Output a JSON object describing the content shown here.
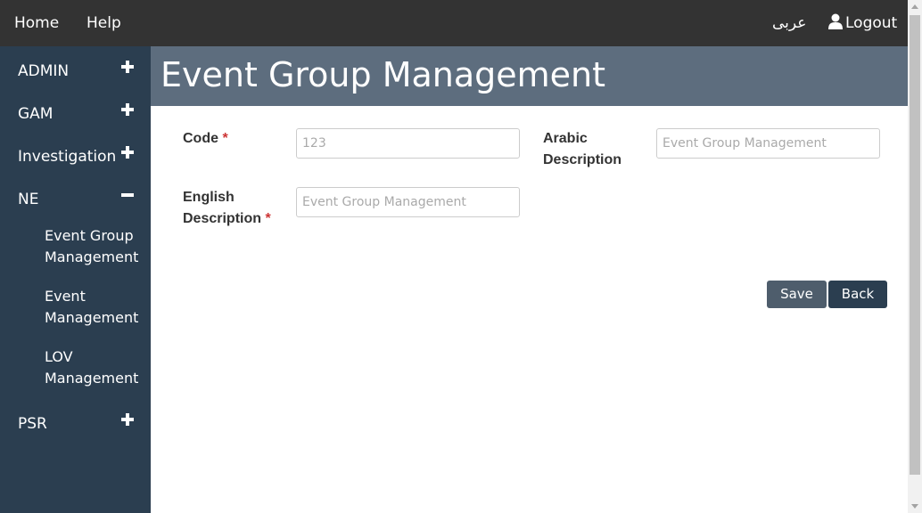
{
  "topbar": {
    "home": "Home",
    "help": "Help",
    "language": "عربى",
    "logout": "Logout"
  },
  "sidebar": {
    "items": [
      {
        "label": "ADMIN",
        "state": "collapsed"
      },
      {
        "label": "GAM",
        "state": "collapsed"
      },
      {
        "label": "Investigation",
        "state": "collapsed"
      },
      {
        "label": "NE",
        "state": "expanded"
      },
      {
        "label": "PSR",
        "state": "collapsed"
      }
    ],
    "ne_children": [
      {
        "line1": "Event Group",
        "line2": "Management"
      },
      {
        "line1": "Event",
        "line2": "Management"
      },
      {
        "line1": "LOV",
        "line2": "Management"
      }
    ]
  },
  "page": {
    "title": "Event Group Management"
  },
  "form": {
    "code_label": "Code",
    "code_placeholder": "123",
    "arabic_label_1": "Arabic",
    "arabic_label_2": "Description",
    "arabic_placeholder": "Event Group Management",
    "english_label_1": "English",
    "english_label_2": "Description",
    "english_placeholder": "Event Group Management",
    "required_mark": "*"
  },
  "buttons": {
    "save": "Save",
    "back": "Back"
  },
  "colors": {
    "topbar": "#333333",
    "sidebar": "#2b3e50",
    "header": "#5d6d7e",
    "required": "#cc3333"
  }
}
